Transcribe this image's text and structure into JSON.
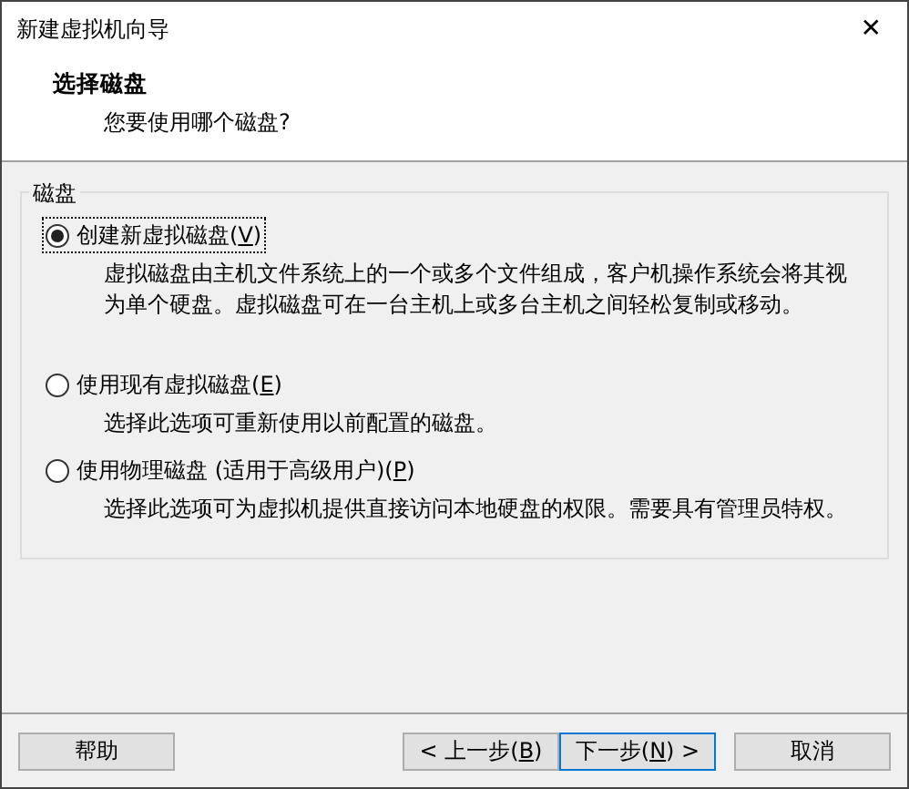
{
  "window": {
    "title": "新建虚拟机向导",
    "close": "✕"
  },
  "header": {
    "title": "选择磁盘",
    "subtitle": "您要使用哪个磁盘?"
  },
  "group": {
    "label": "磁盘",
    "options": [
      {
        "label": "创建新虚拟磁盘(V)",
        "selected": true,
        "description": "虚拟磁盘由主机文件系统上的一个或多个文件组成，客户机操作系统会将其视为单个硬盘。虚拟磁盘可在一台主机上或多台主机之间轻松复制或移动。"
      },
      {
        "label": "使用现有虚拟磁盘(E)",
        "selected": false,
        "description": "选择此选项可重新使用以前配置的磁盘。"
      },
      {
        "label": "使用物理磁盘 (适用于高级用户)(P)",
        "selected": false,
        "description": "选择此选项可为虚拟机提供直接访问本地硬盘的权限。需要具有管理员特权。"
      }
    ]
  },
  "buttons": [
    {
      "label": "帮助",
      "kind": "help"
    },
    {
      "label": "< 上一步(B)",
      "kind": "back"
    },
    {
      "label": "下一步(N) >",
      "kind": "next"
    },
    {
      "label": "取消",
      "kind": "cancel"
    }
  ]
}
